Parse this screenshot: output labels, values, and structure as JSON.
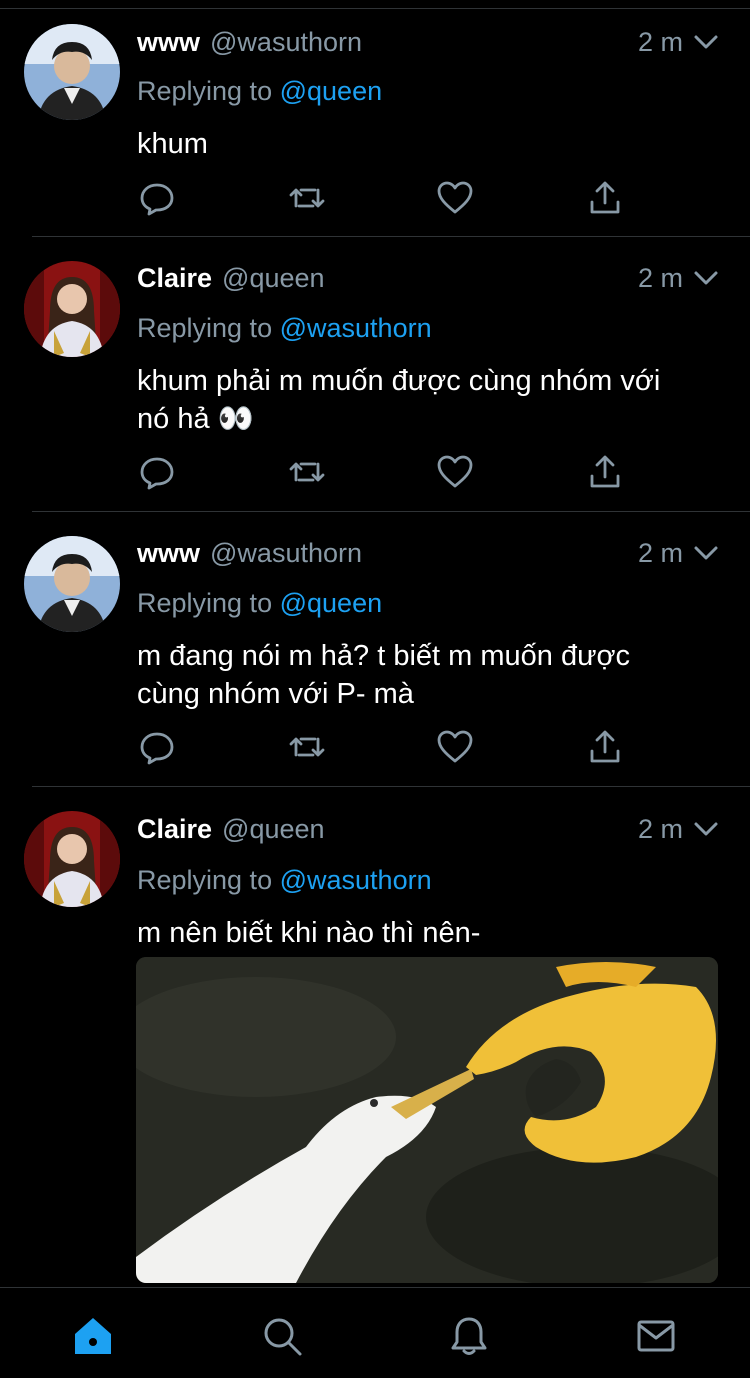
{
  "tweets": [
    {
      "name": "www",
      "handle": "@wasuthorn",
      "time": "2 m",
      "replying_prefix": "Replying to",
      "replying_to": "@queen",
      "text": "khum",
      "avatar": "male-avatar"
    },
    {
      "name": "Claire",
      "handle": "@queen",
      "time": "2 m",
      "replying_prefix": "Replying to",
      "replying_to": "@wasuthorn",
      "text_line1": "khum phải m muốn được cùng nhóm với",
      "text_line2": "nó hả 👀",
      "avatar": "female-avatar"
    },
    {
      "name": "www",
      "handle": "@wasuthorn",
      "time": "2 m",
      "replying_prefix": "Replying to",
      "replying_to": "@queen",
      "text_line1": "m đang nói m hả? t biết m muốn được",
      "text_line2": "cùng nhóm với P- mà",
      "avatar": "male-avatar"
    },
    {
      "name": "Claire",
      "handle": "@queen",
      "time": "2 m",
      "replying_prefix": "Replying to",
      "replying_to": "@wasuthorn",
      "text": "m nên biết khi nào thì nên-",
      "avatar": "female-avatar",
      "media": "bird-and-ok-hand-meme-image"
    }
  ],
  "tabs": [
    "home-icon",
    "search-icon",
    "notifications-icon",
    "messages-icon"
  ],
  "colors": {
    "accent": "#1da1f2",
    "secondary": "#8899a6",
    "background": "#000000"
  }
}
